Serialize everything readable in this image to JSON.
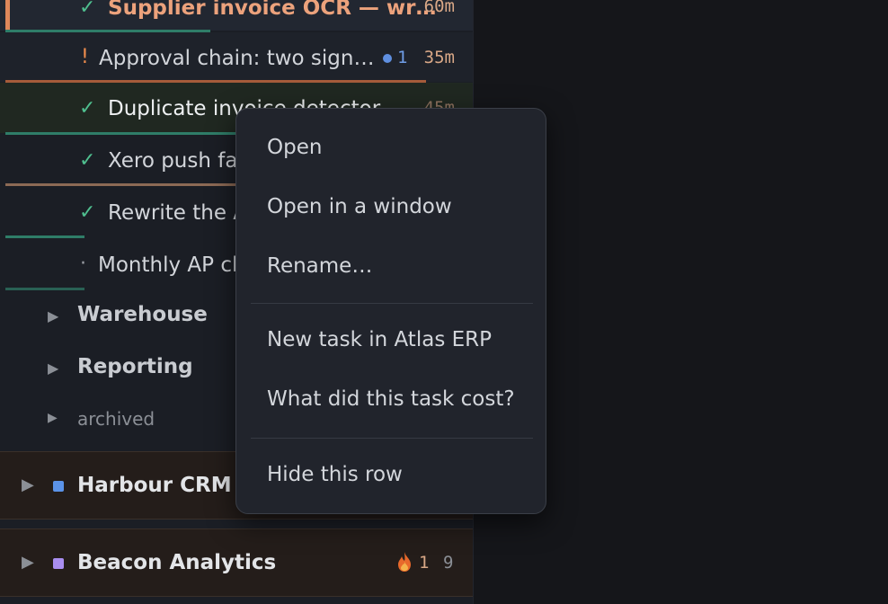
{
  "sidebar": {
    "tasks": [
      {
        "mark": "✓",
        "title": "Supplier invoice OCR — wr…",
        "time": "60m"
      },
      {
        "mark": "!",
        "title": "Approval chain: two sign…",
        "badge": "1",
        "time": "35m"
      },
      {
        "mark": "✓",
        "title": "Duplicate invoice detector",
        "time": "45m"
      },
      {
        "mark": "✓",
        "title": "Xero push fai"
      },
      {
        "mark": "✓",
        "title": "Rewrite the A"
      },
      {
        "mark": "·",
        "title": "Monthly AP cl"
      }
    ],
    "groups": [
      {
        "label": "Warehouse"
      },
      {
        "label": "Reporting"
      },
      {
        "label": "archived"
      }
    ],
    "projects": [
      {
        "label": "Harbour CRM",
        "color": "#5b93e8"
      },
      {
        "label": "Beacon Analytics",
        "color": "#a98ef0",
        "fire_count": "1",
        "count": "9"
      }
    ]
  },
  "context_menu": {
    "items": [
      "Open",
      "Open in a window",
      "Rename…",
      "New task in Atlas ERP",
      "What did this task cost?",
      "Hide this row"
    ]
  },
  "icons": {
    "check": "check-icon",
    "warning": "exclamation-icon",
    "expand": "triangle-right-icon",
    "fire": "fire-icon"
  }
}
